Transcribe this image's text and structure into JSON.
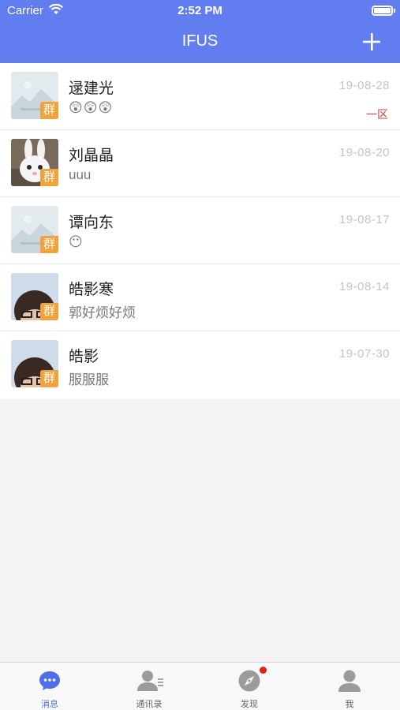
{
  "status_bar": {
    "carrier": "Carrier",
    "time": "2:52 PM"
  },
  "nav": {
    "title": "IFUS",
    "add_icon": "plus-icon"
  },
  "colors": {
    "header": "#617df0",
    "badge": "#f2a23a",
    "tag": "#e5353e",
    "tab_active": "#4f6ee8",
    "notification_dot": "#e41d1d"
  },
  "conversations": [
    {
      "name": "逯建光",
      "preview": "😲😲😲",
      "date": "19-08-28",
      "tag": "一区",
      "badge": "群",
      "avatar": "placeholder-image"
    },
    {
      "name": "刘晶晶",
      "preview": "uuu",
      "date": "19-08-20",
      "tag": "",
      "badge": "群",
      "avatar": "white-rabbit-photo"
    },
    {
      "name": "谭向东",
      "preview": "😶",
      "date": "19-08-17",
      "tag": "",
      "badge": "群",
      "avatar": "placeholder-image"
    },
    {
      "name": "皓影寒",
      "preview": "郭好烦好烦",
      "date": "19-08-14",
      "tag": "",
      "badge": "群",
      "avatar": "person-glasses-photo"
    },
    {
      "name": "皓影",
      "preview": "服服服",
      "date": "19-07-30",
      "tag": "",
      "badge": "群",
      "avatar": "person-glasses-photo"
    }
  ],
  "tabs": [
    {
      "label": "消息",
      "icon": "chat-bubble-icon",
      "active": true
    },
    {
      "label": "通讯录",
      "icon": "contacts-icon",
      "active": false
    },
    {
      "label": "发现",
      "icon": "compass-icon",
      "active": false,
      "has_notification": true
    },
    {
      "label": "我",
      "icon": "person-icon",
      "active": false
    }
  ]
}
